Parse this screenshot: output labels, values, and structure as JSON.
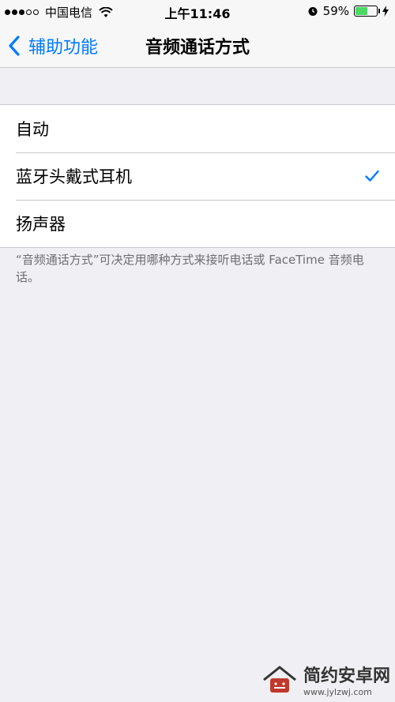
{
  "status_bar": {
    "carrier": "中国电信",
    "time": "上午11:46",
    "battery_percent_label": "59%",
    "battery_level": 0.59,
    "signal_filled": 3,
    "signal_total": 5
  },
  "nav": {
    "back_label": "辅助功能",
    "title": "音频通话方式"
  },
  "options": [
    {
      "label": "自动",
      "selected": false
    },
    {
      "label": "蓝牙头戴式耳机",
      "selected": true
    },
    {
      "label": "扬声器",
      "selected": false
    }
  ],
  "footer_note": "“音频通话方式”可决定用哪种方式来接听电话或 FaceTime 音频电话。",
  "watermark": {
    "title": "简约安卓网",
    "url": "www.jylzwj.com"
  },
  "colors": {
    "accent": "#007aff",
    "background": "#efeff4",
    "battery": "#4cd964"
  }
}
